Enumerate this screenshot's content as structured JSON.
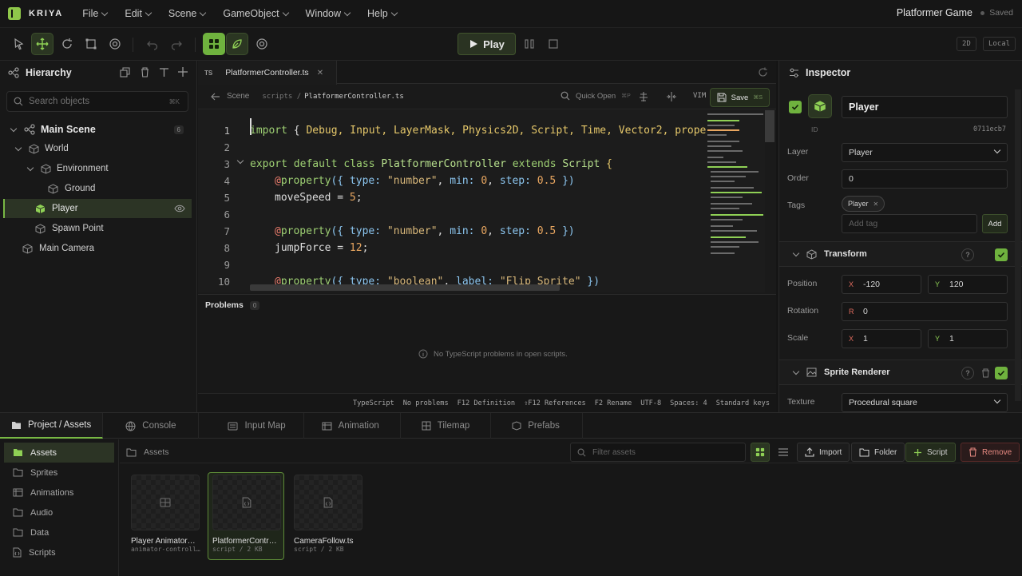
{
  "app": {
    "brand": "KRIYA",
    "project": "Platformer Game",
    "saved": "Saved"
  },
  "menu": [
    "File",
    "Edit",
    "Scene",
    "GameObject",
    "Window",
    "Help"
  ],
  "toolbar": {
    "play": "Play",
    "mode_2d": "2D",
    "space": "Local"
  },
  "hierarchy": {
    "title": "Hierarchy",
    "search_placeholder": "Search objects",
    "search_kbd": "⌘K",
    "scene": "Main Scene",
    "scene_count": "6",
    "items": [
      "World",
      "Environment",
      "Ground",
      "Player",
      "Spawn Point",
      "Main Camera"
    ]
  },
  "editor": {
    "tab": "PlatformerController.ts",
    "tab_lang": "TS",
    "crumb_back": "Scene",
    "crumb_path": "scripts /",
    "crumb_file": "PlatformerController.ts",
    "quick_open": "Quick Open",
    "quick_open_kbd": "⌘P",
    "vim": "VIM",
    "save": "Save",
    "save_kbd": "⌘S",
    "line_numbers": [
      "1",
      "2",
      "3",
      "4",
      "5",
      "6",
      "7",
      "8",
      "9",
      "10"
    ],
    "lines": {
      "l1": "import { Debug, Input, LayerMask, Physics2D, Script, Time, Vector2, prope",
      "l3": "export default class PlatformerController extends Script {",
      "l4": "@property({ type: \"number\", min: 0, step: 0.5 })",
      "l5": "moveSpeed = 5;",
      "l7": "@property({ type: \"number\", min: 0, step: 0.5 })",
      "l8": "jumpForce = 12;",
      "l10": "@property({ type: \"boolean\", label: \"Flip Sprite\" })"
    },
    "problems_title": "Problems",
    "problems_count": "0",
    "problems_empty": "No TypeScript problems in open scripts.",
    "status": [
      "TypeScript",
      "No problems",
      "F12 Definition",
      "⇧F12 References",
      "F2 Rename",
      "UTF-8",
      "Spaces: 4",
      "Standard keys"
    ]
  },
  "inspector": {
    "title": "Inspector",
    "name": "Player",
    "id_label": "ID",
    "id_value": "0711ecb7",
    "layer_label": "Layer",
    "layer_value": "Player",
    "order_label": "Order",
    "order_value": "0",
    "tags_label": "Tags",
    "tag": "Player",
    "add_tag_placeholder": "Add tag",
    "add_button": "Add",
    "transform": "Transform",
    "position_label": "Position",
    "pos_x": "-120",
    "pos_y": "120",
    "rotation_label": "Rotation",
    "rot_r": "0",
    "scale_label": "Scale",
    "scale_x": "1",
    "scale_y": "1",
    "sprite_renderer": "Sprite Renderer",
    "texture_label": "Texture",
    "texture_value": "Procedural square",
    "axis_x": "X",
    "axis_y": "Y",
    "axis_r": "R",
    "help": "?"
  },
  "bottom": {
    "tabs": [
      "Project / Assets",
      "Console",
      "Input Map",
      "Animation",
      "Tilemap",
      "Prefabs"
    ],
    "folders": [
      "Assets",
      "Sprites",
      "Animations",
      "Audio",
      "Data",
      "Scripts"
    ],
    "breadcrumb": "Assets",
    "filter_placeholder": "Filter assets",
    "buttons": {
      "import": "Import",
      "folder": "Folder",
      "script": "Script",
      "remove": "Remove"
    },
    "assets": [
      {
        "name": "Player Animator…",
        "sub": "animator-controll…"
      },
      {
        "name": "PlatformerContr…",
        "sub": "script / 2 KB"
      },
      {
        "name": "CameraFollow.ts",
        "sub": "script / 2 KB"
      }
    ]
  },
  "colors": {
    "accent": "#78b844",
    "accent_dark": "#2c3425",
    "danger": "#d9534f"
  }
}
